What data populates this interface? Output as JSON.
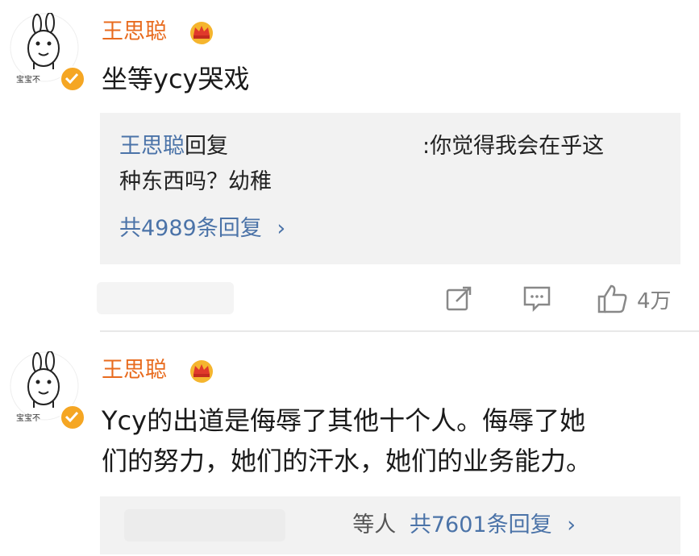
{
  "comments": [
    {
      "username": "王思聪",
      "avatar_label": "宝宝不",
      "text": "坐等ycy哭戏",
      "reply": {
        "author": "王思聪",
        "action": "回复",
        "content_line1": ":你觉得我会在乎这",
        "content_line2": "种东西吗？幼稚",
        "count_label": "共4989条回复",
        "chevron": "›"
      },
      "actions": {
        "like_count": "4万"
      }
    },
    {
      "username": "王思聪",
      "avatar_label": "宝宝不",
      "text_line1": "Ycy的出道是侮辱了其他十个人。侮辱了她",
      "text_line2": "们的努力，她们的汗水，她们的业务能力。",
      "summary": {
        "prefix": "等人",
        "count_label": "共7601条回复",
        "chevron": "›"
      }
    }
  ],
  "colors": {
    "username": "#e86b1e",
    "link": "#4b73a8",
    "reply_bg": "#f2f2f2",
    "verified": "#f5a623"
  },
  "icons": [
    "rabbit-avatar",
    "verified-badge-icon",
    "crown-icon",
    "share-icon",
    "comment-icon",
    "like-icon",
    "chevron-right-icon"
  ]
}
